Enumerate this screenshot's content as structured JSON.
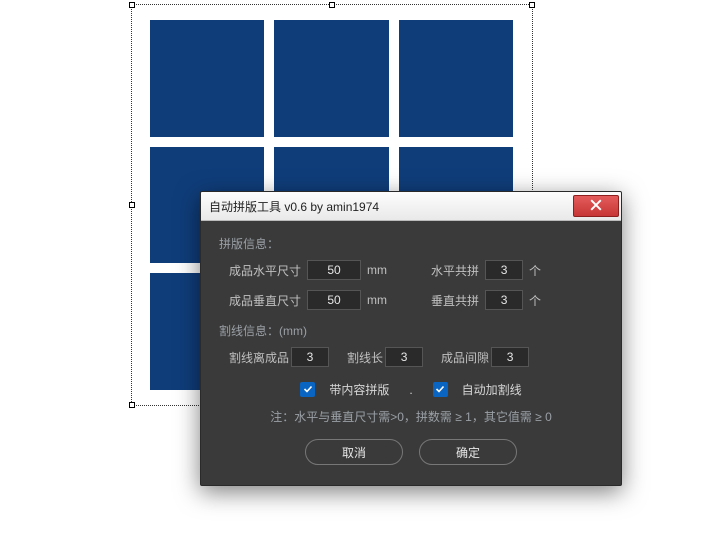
{
  "dialog": {
    "title": "自动拼版工具 v0.6   by amin1974",
    "section1_label": "拼版信息：",
    "size_h_label": "成品水平尺寸",
    "size_h_value": "50",
    "size_h_unit": "mm",
    "count_h_label": "水平共拼",
    "count_h_value": "3",
    "count_h_unit": "个",
    "size_v_label": "成品垂直尺寸",
    "size_v_value": "50",
    "size_v_unit": "mm",
    "count_v_label": "垂直共拼",
    "count_v_value": "3",
    "count_v_unit": "个",
    "section2_label": "割线信息：(mm)",
    "cut_off_label": "割线离成品",
    "cut_off_value": "3",
    "cut_len_label": "割线长",
    "cut_len_value": "3",
    "gap_label": "成品间隙",
    "gap_value": "3",
    "cb1_label": "带内容拼版",
    "cb2_label": "自动加割线",
    "note": "注：水平与垂直尺寸需>0，拼数需 ≥ 1，其它值需 ≥ 0",
    "cancel": "取消",
    "ok": "确定"
  },
  "colors": {
    "cell": "#0f3d7a",
    "dialog_bg": "#3a3a3a",
    "accent": "#0a64c2",
    "close": "#c73636"
  }
}
